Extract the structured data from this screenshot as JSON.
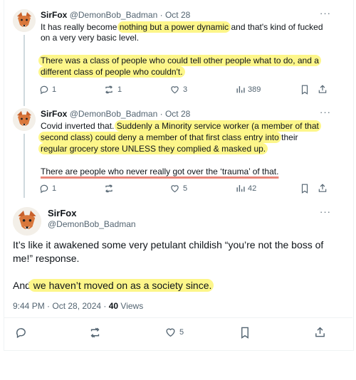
{
  "tweets": [
    {
      "name": "SirFox",
      "handle": "@DemonBob_Badman",
      "date": "Oct 28",
      "p1": [
        {
          "pre": "It has really become ",
          "hl": "nothing but a power dynamic",
          "post": " and that's kind of fucked"
        },
        {
          "pre": "on a very very basic level.",
          "hl": "",
          "post": ""
        }
      ],
      "p2": [
        "There was a class of people who could tell other people what to do, and a",
        "different class of people who couldn't."
      ],
      "actions": {
        "replies": "1",
        "reposts": "1",
        "likes": "3",
        "views": "389"
      }
    },
    {
      "name": "SirFox",
      "handle": "@DemonBob_Badman",
      "date": "Oct 28",
      "p1_pre": "Covid inverted that. ",
      "p1_hl": "Suddenly a Minority service worker (a member of that",
      "p2_hl": "second class) could deny a member of that first class entry into",
      "p2_post": " their",
      "p3_hl": "regular grocery store UNLESS they complied & masked up.",
      "p4": "There are people who never really got over the ‘trauma’ of that.",
      "actions": {
        "replies": "1",
        "likes": "5",
        "views": "42"
      }
    }
  ],
  "main": {
    "name": "SirFox",
    "handle": "@DemonBob_Badman",
    "line1": "It’s like it awakened some very petulant childish “you’re not the boss of",
    "line2": "me!” response.",
    "line3_pre": "And",
    "line3_hl": " we haven’t moved on as a society since.",
    "time": "9:44 PM · Oct 28, 2024 · ",
    "views_count": "40",
    "views_label": " Views",
    "likes": "5"
  },
  "icons": [
    "reply-icon",
    "repost-icon",
    "like-icon",
    "views-icon",
    "bookmark-icon",
    "share-icon",
    "more-icon"
  ],
  "colors": {
    "highlight": "#fdf68a",
    "underline": "#e8877a",
    "muted": "#536471"
  }
}
